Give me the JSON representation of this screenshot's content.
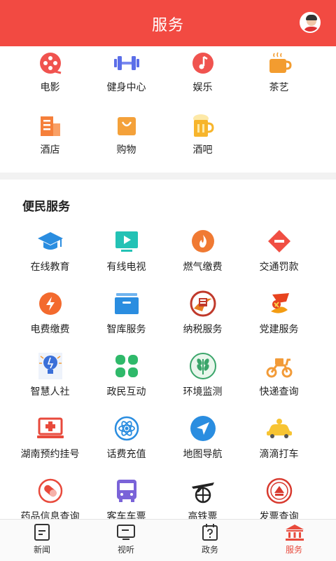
{
  "header": {
    "title": "服务"
  },
  "entertainment": {
    "items": [
      {
        "label": "电影",
        "icon": "film-icon",
        "color": "#f0534f"
      },
      {
        "label": "健身中心",
        "icon": "dumbbell-icon",
        "color": "#5b6ee8"
      },
      {
        "label": "娱乐",
        "icon": "music-note-icon",
        "color": "#f0534f"
      },
      {
        "label": "茶艺",
        "icon": "tea-cup-icon",
        "color": "#f39c2f"
      },
      {
        "label": "酒店",
        "icon": "hotel-icon",
        "color": "#f57f3a"
      },
      {
        "label": "购物",
        "icon": "shopping-bag-icon",
        "color": "#f4a13a"
      },
      {
        "label": "酒吧",
        "icon": "beer-icon",
        "color": "#f7b52c"
      }
    ]
  },
  "convenience": {
    "title": "便民服务",
    "items": [
      {
        "label": "在线教育",
        "icon": "graduation-cap-icon",
        "color": "#2a8de0"
      },
      {
        "label": "有线电视",
        "icon": "tv-play-icon",
        "color": "#23c2b5"
      },
      {
        "label": "燃气缴费",
        "icon": "flame-icon",
        "color": "#f07a33"
      },
      {
        "label": "交通罚款",
        "icon": "no-entry-icon",
        "color": "#f04f43"
      },
      {
        "label": "电费缴费",
        "icon": "lightning-icon",
        "color": "#f36a2e"
      },
      {
        "label": "智库服务",
        "icon": "archive-box-icon",
        "color": "#2a8de0"
      },
      {
        "label": "纳税服务",
        "icon": "tax-emblem-icon",
        "color": "#c0392b"
      },
      {
        "label": "党建服务",
        "icon": "party-emblem-icon",
        "color": "#e8431e"
      },
      {
        "label": "智慧人社",
        "icon": "smart-bulb-icon",
        "color": "#3a6fd8"
      },
      {
        "label": "政民互动",
        "icon": "clover-icon",
        "color": "#2fb96a"
      },
      {
        "label": "环境监测",
        "icon": "leaf-emblem-icon",
        "color": "#3aa56a"
      },
      {
        "label": "快递查询",
        "icon": "scooter-icon",
        "color": "#f29b38"
      },
      {
        "label": "湖南预约挂号",
        "icon": "medical-laptop-icon",
        "color": "#e84a3c"
      },
      {
        "label": "话费充值",
        "icon": "atom-icon",
        "color": "#2a8de0"
      },
      {
        "label": "地图导航",
        "icon": "navigation-arrow-icon",
        "color": "#2a8de0"
      },
      {
        "label": "滴滴打车",
        "icon": "taxi-icon",
        "color": "#f7c433"
      },
      {
        "label": "药品信息查询",
        "icon": "pill-icon",
        "color": "#e84a3c"
      },
      {
        "label": "客车车票",
        "icon": "bus-icon",
        "color": "#7a63d8"
      },
      {
        "label": "高铁票",
        "icon": "plane-globe-icon",
        "color": "#222222"
      },
      {
        "label": "发票查询",
        "icon": "seal-icon",
        "color": "#d83a2f"
      }
    ]
  },
  "tabbar": {
    "tabs": [
      {
        "label": "新闻",
        "icon": "news-icon",
        "active": false
      },
      {
        "label": "视听",
        "icon": "tv-icon",
        "active": false
      },
      {
        "label": "政务",
        "icon": "calendar-question-icon",
        "active": false
      },
      {
        "label": "服务",
        "icon": "government-building-icon",
        "active": true
      }
    ]
  },
  "colors": {
    "brand": "#f24a42",
    "active_tab": "#e84a3c"
  }
}
